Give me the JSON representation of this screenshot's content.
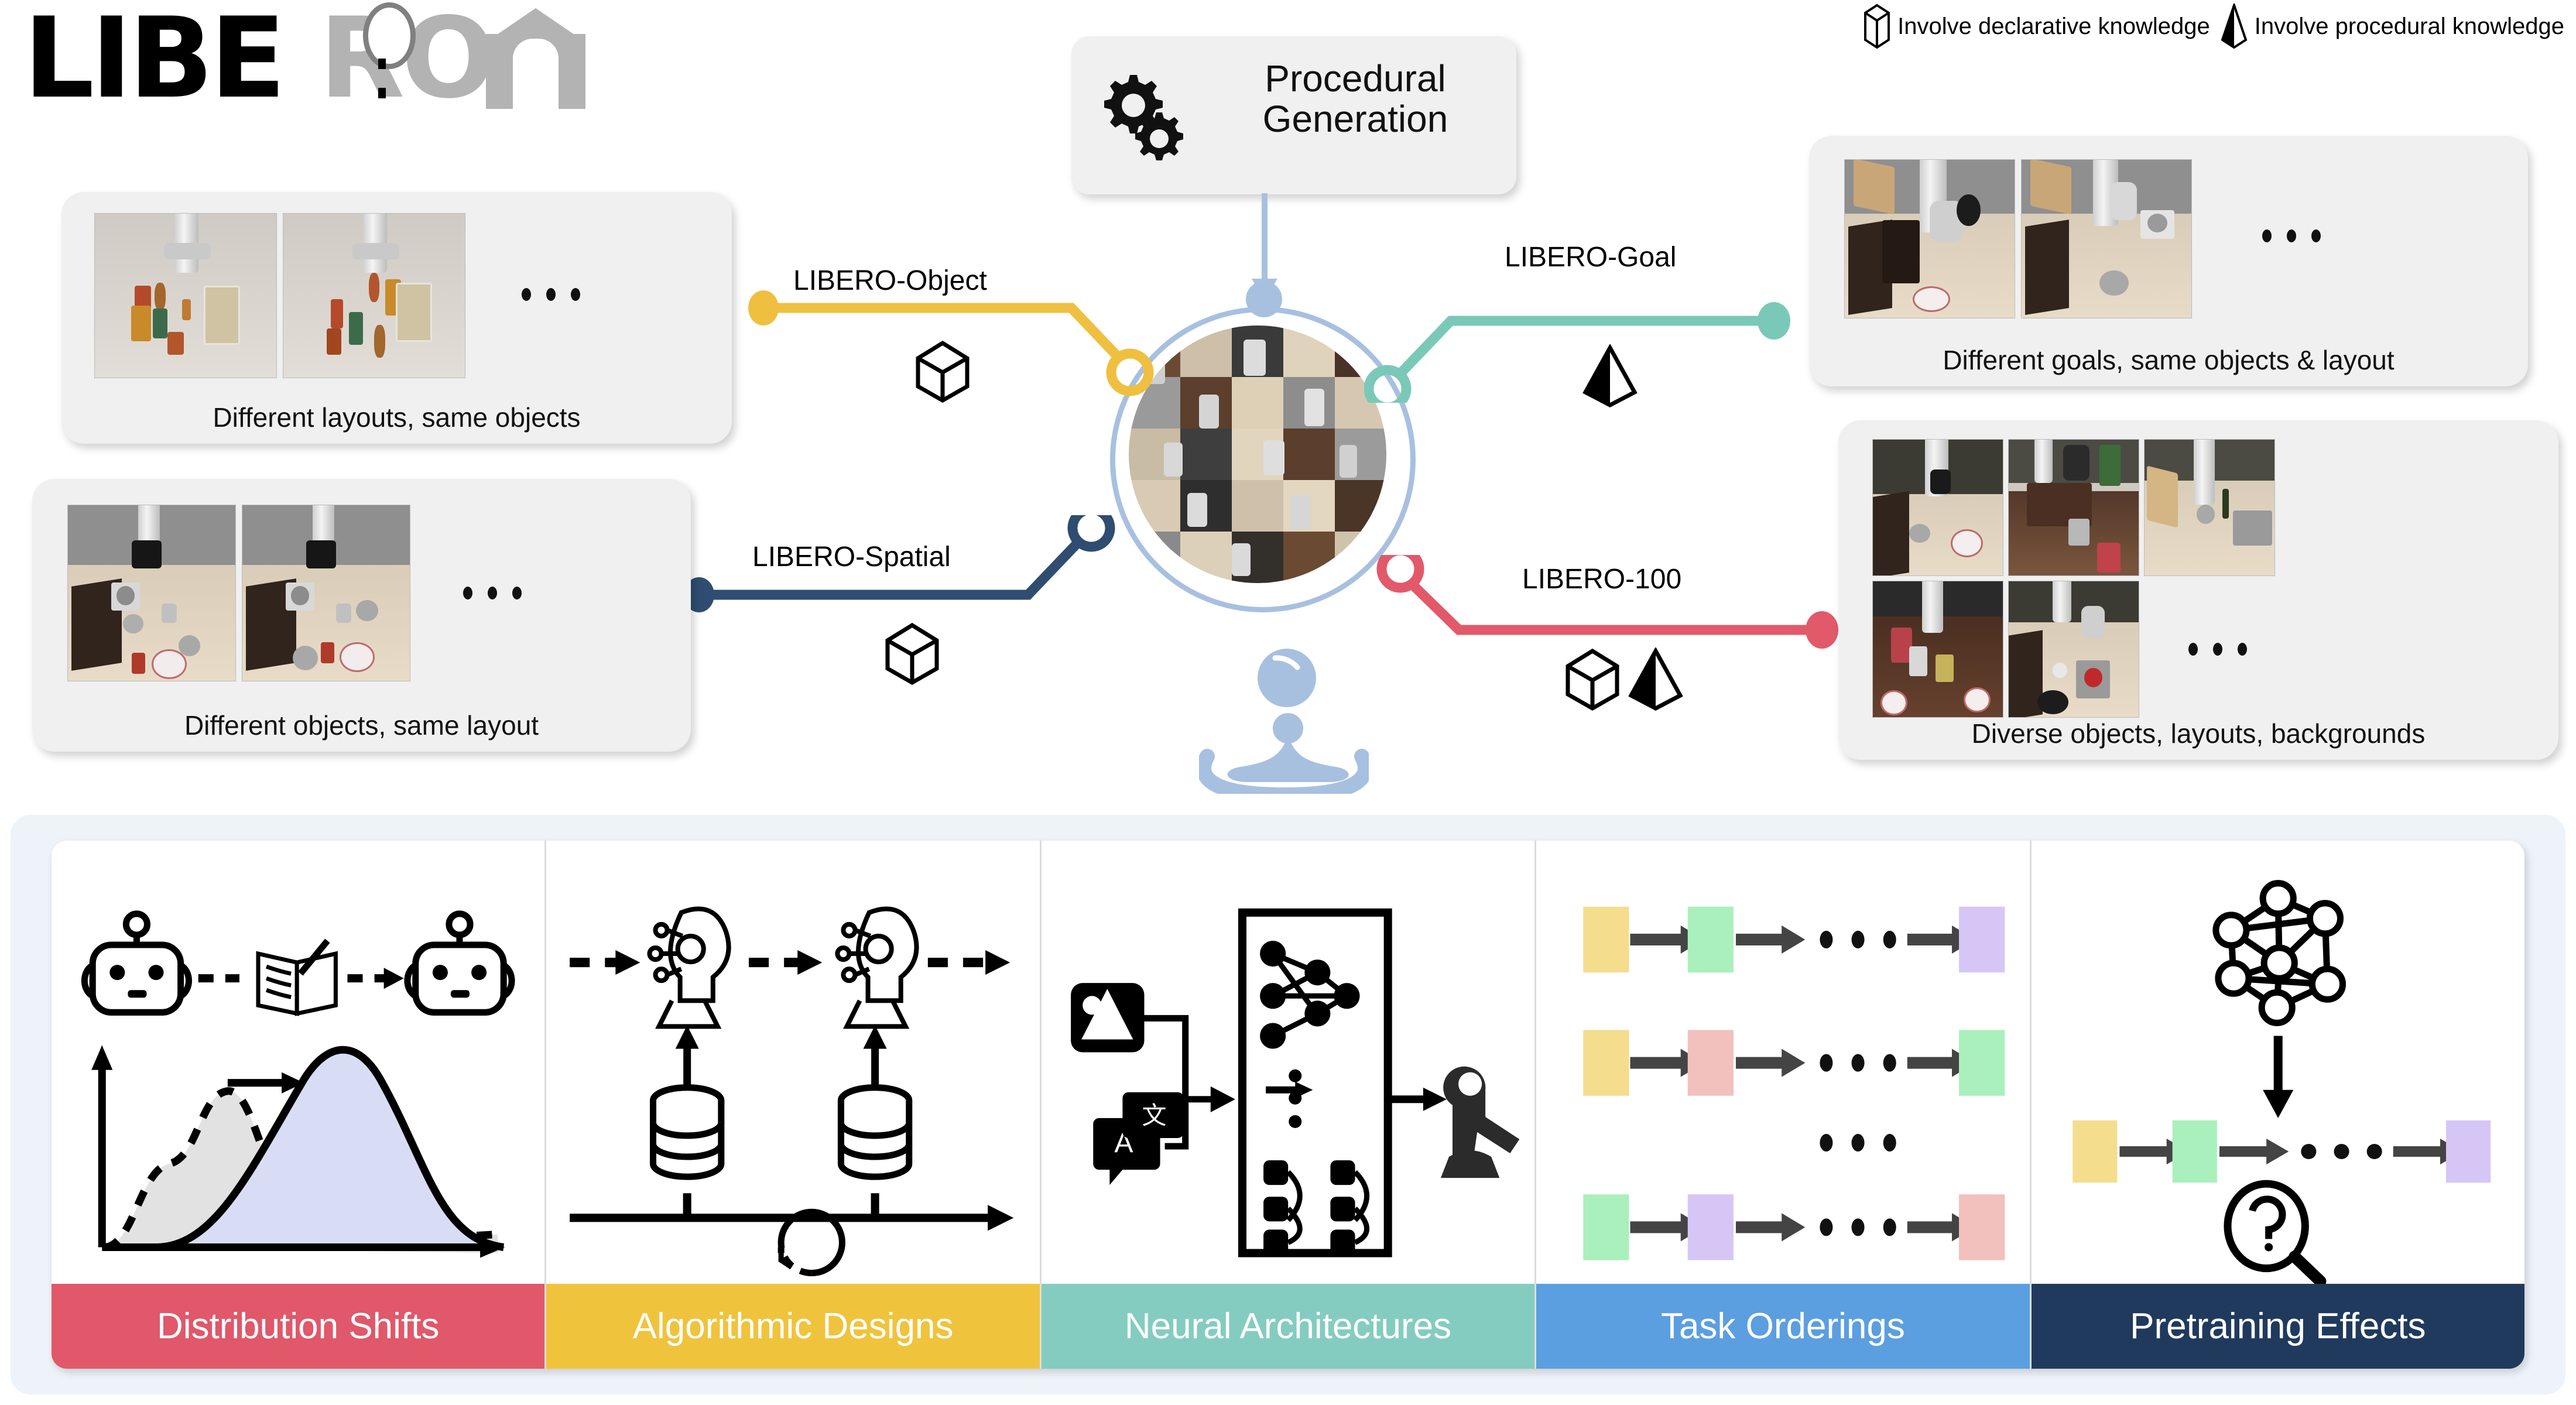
{
  "logo": {
    "text_black": "LIBE",
    "text_gray": "RO",
    "full": "LIBERO"
  },
  "legend": {
    "items": [
      {
        "icon": "declarative-cube-icon",
        "label": "Involve declarative knowledge"
      },
      {
        "icon": "procedural-pyramid-icon",
        "label": "Involve procedural knowledge"
      }
    ]
  },
  "generator": {
    "label_line1": "Procedural",
    "label_line2": "Generation",
    "icon": "gears-icon"
  },
  "hub": {
    "icon": "task-mosaic-circle",
    "droplet_icon": "water-droplet-splash-icon",
    "ring_color": "#a8c0e0"
  },
  "suites": [
    {
      "name": "LIBERO-Object",
      "color": "#efc03f",
      "knowledge": [
        "declarative"
      ],
      "caption": "Different layouts, same objects",
      "shots": 2,
      "ellipsis": "..."
    },
    {
      "name": "LIBERO-Spatial",
      "color": "#2f4d71",
      "knowledge": [
        "declarative"
      ],
      "caption": "Different objects, same layout",
      "shots": 2,
      "ellipsis": "..."
    },
    {
      "name": "LIBERO-Goal",
      "color": "#7ac9b8",
      "knowledge": [
        "procedural"
      ],
      "caption": "Different goals, same objects & layout",
      "shots": 2,
      "ellipsis": "..."
    },
    {
      "name": "LIBERO-100",
      "color": "#e2596a",
      "knowledge": [
        "declarative",
        "procedural"
      ],
      "caption": "Diverse objects, layouts, backgrounds",
      "shots": 5,
      "ellipsis": "..."
    }
  ],
  "study_topics": [
    {
      "label": "Distribution Shifts",
      "color": "#e0586a",
      "icons": [
        "robot-head-icon",
        "book-pen-icon",
        "robot-head-icon",
        "distribution-shift-plot"
      ]
    },
    {
      "label": "Algorithmic Designs",
      "color": "#f0c33c",
      "icons": [
        "ai-head-icon",
        "database-icon",
        "ai-head-icon",
        "database-icon",
        "timeline-arrow-icon",
        "clock-icon"
      ]
    },
    {
      "label": "Neural Architectures",
      "color": "#84ccc0",
      "icons": [
        "image-icon",
        "language-icon",
        "neural-network-icon",
        "transformer-icon",
        "robot-arm-icon"
      ]
    },
    {
      "label": "Task Orderings",
      "color": "#5b9fe0",
      "icons": [
        "task-block-sequence"
      ],
      "sequences": [
        [
          "#f5dd8e",
          "#aaf0bc",
          "#d6c6f5"
        ],
        [
          "#f5dd8e",
          "#f2c0bd",
          "#aaf0bc"
        ],
        [
          "#aaf0bc",
          "#d6c6f5",
          "#f2c0bd"
        ]
      ]
    },
    {
      "label": "Pretraining Effects",
      "color": "#203a5e",
      "icons": [
        "neural-network-icon",
        "magnifier-question-icon",
        "task-block-sequence"
      ],
      "sequence": [
        "#f5dd8e",
        "#aaf0bc",
        "#d6c6f5"
      ]
    }
  ]
}
